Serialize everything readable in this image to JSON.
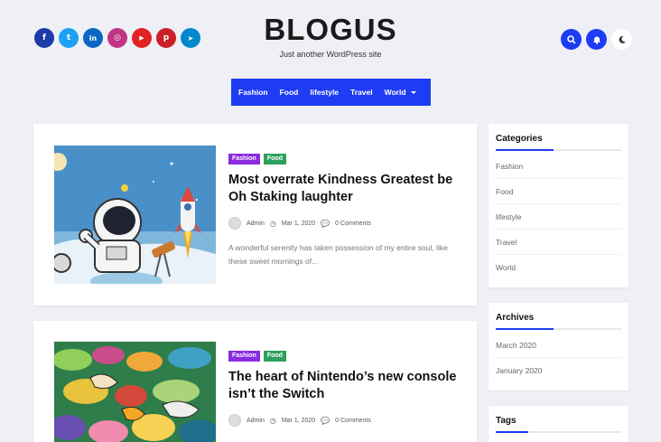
{
  "social": [
    {
      "name": "facebook",
      "glyph": "f",
      "color": "#1e3ca8"
    },
    {
      "name": "twitter",
      "glyph": "t",
      "color": "#1da1f2"
    },
    {
      "name": "linkedin",
      "glyph": "in",
      "color": "#0a66c2"
    },
    {
      "name": "instagram",
      "glyph": "◎",
      "color": "#c13584"
    },
    {
      "name": "youtube",
      "glyph": "▶",
      "color": "#e02222"
    },
    {
      "name": "pinterest",
      "glyph": "p",
      "color": "#cb2027"
    },
    {
      "name": "telegram",
      "glyph": "➤",
      "color": "#0088cc"
    }
  ],
  "brand": {
    "title": "BLOGUS",
    "tagline": "Just another WordPress site"
  },
  "nav": {
    "items": [
      "Fashion",
      "Food",
      "lifestyle",
      "Travel",
      "World"
    ]
  },
  "posts": [
    {
      "categories": [
        "Fashion",
        "Food"
      ],
      "title": "Most overrate Kindness Greatest be Oh Staking laughter",
      "author": "Admin",
      "date": "Mar 1, 2020",
      "comments": "0 Comments",
      "excerpt": "A wonderful serenity has taken possession of my entire soul, like these sweet mornings of..."
    },
    {
      "categories": [
        "Fashion",
        "Food"
      ],
      "title": "The heart of Nintendo’s new console isn’t the Switch",
      "author": "Admin",
      "date": "Mar 1, 2020",
      "comments": "0 Comments"
    }
  ],
  "sidebar": {
    "categories": {
      "title": "Categories",
      "items": [
        "Fashion",
        "Food",
        "lifestyle",
        "Travel",
        "World"
      ]
    },
    "archives": {
      "title": "Archives",
      "items": [
        "March 2020",
        "January 2020"
      ]
    },
    "tags": {
      "title": "Tags"
    }
  },
  "colors": {
    "accent": "#1e3cf2",
    "fashion_badge": "#8a2be2",
    "food_badge": "#2ea05a"
  }
}
